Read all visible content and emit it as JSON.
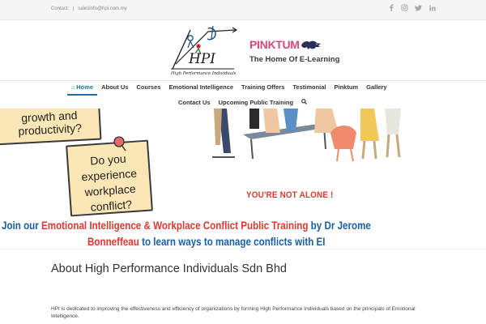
{
  "topbar": {
    "contact_label": "Contact:",
    "separator": "|",
    "email": "salesinfo@hpi.com.my",
    "social_icons": [
      "facebook-icon",
      "instagram-icon",
      "twitter-icon",
      "linkedin-icon"
    ]
  },
  "header": {
    "logo_text": "HPI",
    "logo_subtitle": "High Performance Individuals",
    "partner_brand": "PINKTUM",
    "tagline": "The Home Of E-Learning"
  },
  "nav": {
    "row1": [
      {
        "label": "Home",
        "active": true,
        "icon": "home-icon"
      },
      {
        "label": "About Us"
      },
      {
        "label": "Courses"
      },
      {
        "label": "Emotional Intelligence"
      },
      {
        "label": "Training Offers"
      },
      {
        "label": "Testimonial"
      },
      {
        "label": "Pinktum"
      },
      {
        "label": "Gallery"
      }
    ],
    "row2": [
      {
        "label": "Contact Us"
      },
      {
        "label": "Upcoming Public Training"
      }
    ],
    "search_icon": "search-icon",
    "active_color": "#1b6fa8"
  },
  "banner": {
    "note1_text": "growth and productivity?",
    "note2_text": "Do you experience workplace conflict?",
    "not_alone": "YOU'RE NOT ALONE !",
    "line1_a": "Join our ",
    "line1_b": "Emotional Intelligence & Workplace Conflict Public Training",
    "line1_c": " by Dr Jerome",
    "line2_a": "Bonneffeau",
    "line2_b": " to learn ways to manage conflicts with EI",
    "colors": {
      "blue": "#1b5fa9",
      "red": "#e4362f",
      "note": "#fbe7b6"
    }
  },
  "content": {
    "title": "About High Performance Individuals Sdn Bhd",
    "paragraph": "HPI is dedicated to improving the effectiveness and efficiency of organizations by forming High Performance Individuals based on the principals of Emotional Intelligence."
  }
}
